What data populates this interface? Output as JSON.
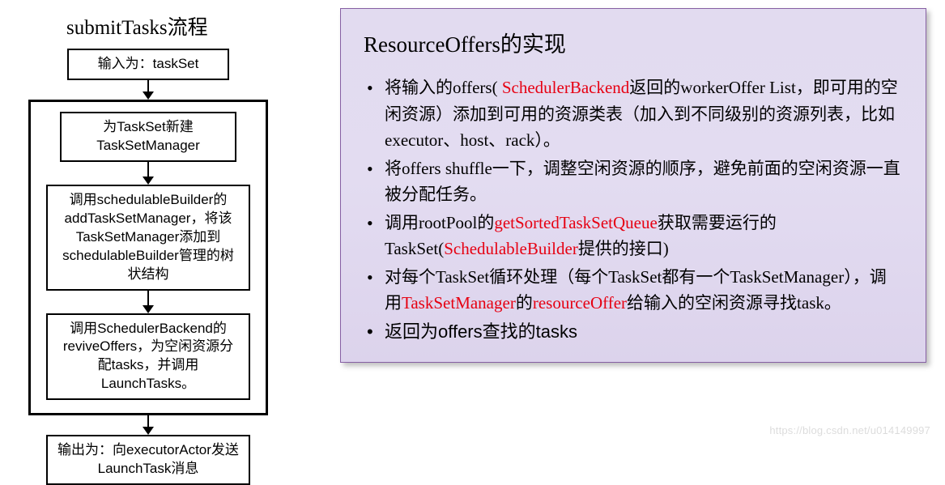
{
  "flow": {
    "title": "submitTasks流程",
    "input": "输入为：taskSet",
    "step1": "为TaskSet新建\nTaskSetManager",
    "step2": "调用schedulableBuilder的addTaskSetManager，将该TaskSetManager添加到schedulableBuilder管理的树状结构",
    "step3": "调用SchedulerBackend的reviveOffers，为空闲资源分配tasks，并调用LaunchTasks。",
    "output": "输出为：向executorActor发送LaunchTask消息"
  },
  "panel": {
    "title": "ResourceOffers的实现",
    "b1a": "将输入的offers(",
    "b1b": " SchedulerBackend",
    "b1c": "返回的workerOffer List，即可用的空闲资源）添加到可用的资源类表（加入到不同级别的资源列表，比如executor、host、rack）。",
    "b2": "将offers  shuffle一下，调整空闲资源的顺序，避免前面的空闲资源一直被分配任务。",
    "b3a": "调用rootPool的",
    "b3b": "getSortedTaskSetQueue",
    "b3c": "获取需要运行的TaskSet(",
    "b3d": "SchedulableBuilder",
    "b3e": "提供的接口)",
    "b4a": "对每个TaskSet循环处理（每个TaskSet都有一个TaskSetManager），调用",
    "b4b": "TaskSetManager",
    "b4c": "的",
    "b4d": "resourceOffer",
    "b4e": "给输入的空闲资源寻找task。",
    "b5": "返回为offers查找的tasks"
  },
  "watermark": "https://blog.csdn.net/u014149997"
}
